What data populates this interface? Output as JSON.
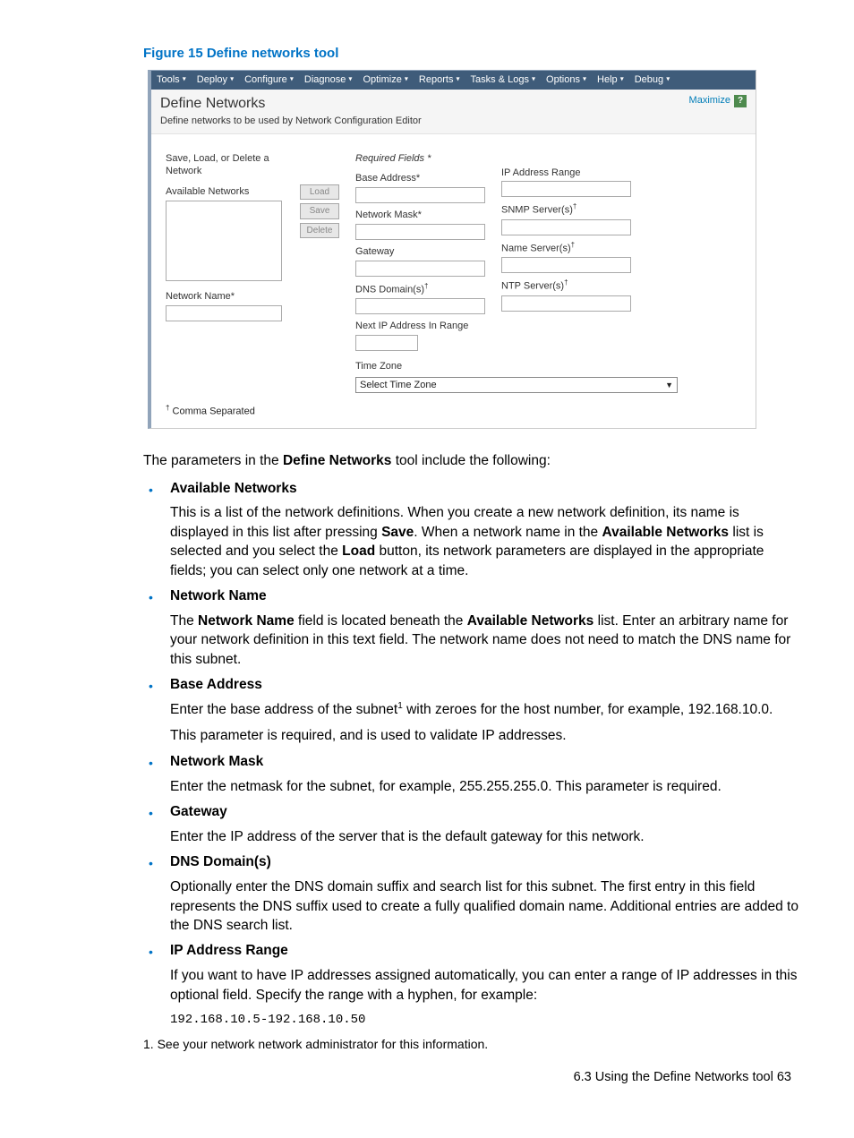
{
  "figure_title": "Figure 15 Define networks tool",
  "menu": [
    "Tools",
    "Deploy",
    "Configure",
    "Diagnose",
    "Optimize",
    "Reports",
    "Tasks & Logs",
    "Options",
    "Help",
    "Debug"
  ],
  "tool": {
    "title": "Define Networks",
    "subtitle": "Define networks to be used by Network Configuration Editor",
    "maximize": "Maximize"
  },
  "col1": {
    "save_load_delete": "Save, Load, or Delete a Network",
    "available_networks": "Available Networks",
    "network_name": "Network Name*"
  },
  "buttons": {
    "load": "Load",
    "save": "Save",
    "delete": "Delete"
  },
  "col2": {
    "required_fields": "Required Fields *",
    "base_address": "Base Address*",
    "network_mask": "Network Mask*",
    "gateway": "Gateway",
    "dns_domains": "DNS Domain(s)",
    "next_ip": "Next IP Address In Range",
    "time_zone_label": "Time Zone",
    "time_zone_value": "Select Time Zone"
  },
  "col3": {
    "ip_range": "IP Address Range",
    "snmp": "SNMP Server(s)",
    "name_servers": "Name Server(s)",
    "ntp": "NTP Server(s)"
  },
  "form_footnote": "Comma Separated",
  "dagger": "†",
  "intro": {
    "pre": "The parameters in the ",
    "bold": "Define Networks",
    "post": " tool include the following:"
  },
  "params": {
    "avail": {
      "title": "Available Networks",
      "p1a": "This is a list of the network definitions. When you create a new network definition, its name is displayed in this list after pressing ",
      "p1b": "Save",
      "p1c": ". When a network name in the ",
      "p1d": "Available Networks",
      "p1e": " list is selected and you select the ",
      "p1f": "Load",
      "p1g": " button, its network parameters are displayed in the appropriate fields; you can select only one network at a time."
    },
    "netname": {
      "title": "Network Name",
      "p1a": "The ",
      "p1b": "Network Name",
      "p1c": " field is located beneath the ",
      "p1d": "Available Networks",
      "p1e": " list. Enter an arbitrary name for your network definition in this text field. The network name does not need to match the DNS name for this subnet."
    },
    "base": {
      "title": "Base Address",
      "p1a": "Enter the base address of the subnet",
      "p1b": " with zeroes for the host number, for example, 192.168.10.0.",
      "p2": "This parameter is required, and is used to validate IP addresses."
    },
    "mask": {
      "title": "Network Mask",
      "body": "Enter the netmask for the subnet, for example, 255.255.255.0. This parameter is required."
    },
    "gateway": {
      "title": "Gateway",
      "body": "Enter the IP address of the server that is the default gateway for this network."
    },
    "dns": {
      "title": "DNS Domain(s)",
      "body": "Optionally enter the DNS domain suffix and search list for this subnet. The first entry in this field represents the DNS suffix used to create a fully qualified domain name. Additional entries are added to the DNS search list."
    },
    "iprange": {
      "title": "IP Address Range",
      "body": "If you want to have IP addresses assigned automatically, you can enter a range of IP addresses in this optional field. Specify the range with a hyphen, for example:",
      "example": "192.168.10.5-192.168.10.50"
    }
  },
  "doc_footnote": "1.  See your network network administrator for this information.",
  "page_footer": "6.3 Using the Define Networks tool    63"
}
